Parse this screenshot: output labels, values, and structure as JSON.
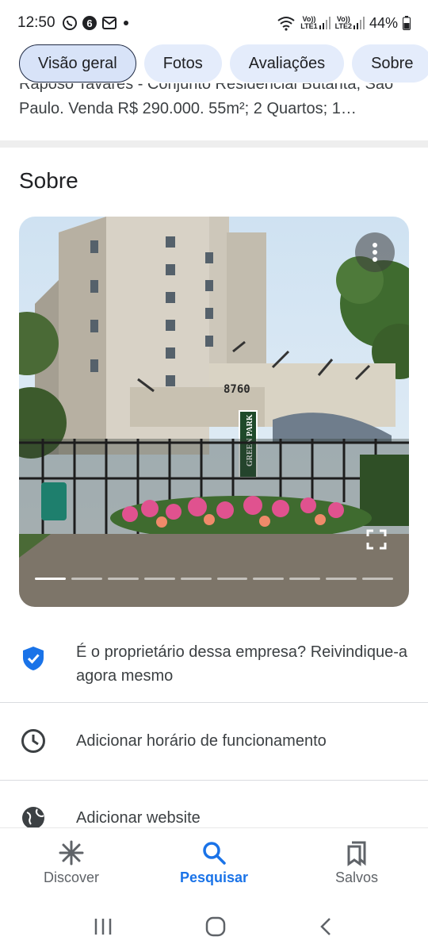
{
  "status_bar": {
    "time": "12:50",
    "battery": "44%",
    "sim1": "LTE1",
    "sim2": "LTE2",
    "volte": "Vo))"
  },
  "tabs": [
    {
      "label": "Visão geral",
      "active": true
    },
    {
      "label": "Fotos",
      "active": false
    },
    {
      "label": "Avaliações",
      "active": false
    },
    {
      "label": "Sobre",
      "active": false
    }
  ],
  "description": {
    "line1": "Raposo Tavares - Conjunto Residencial Butantã, São",
    "line2": "Paulo. Venda R$ 290.000. 55m²; 2 Quartos; 1…"
  },
  "about": {
    "title": "Sobre",
    "photo": {
      "building_number": "8760",
      "sign_text": "GREEN PARK",
      "slide_count": 10,
      "active_slide": 1
    }
  },
  "info_rows": [
    {
      "icon": "verified-shield-icon",
      "text": "É o proprietário dessa empresa? Reivindique-a agora mesmo"
    },
    {
      "icon": "clock-icon",
      "text": "Adicionar horário de funcionamento"
    },
    {
      "icon": "globe-icon",
      "text": "Adicionar website"
    }
  ],
  "bottom_nav": [
    {
      "label": "Discover",
      "icon": "discover-asterisk-icon",
      "active": false
    },
    {
      "label": "Pesquisar",
      "icon": "search-icon",
      "active": true
    },
    {
      "label": "Salvos",
      "icon": "bookmarks-icon",
      "active": false
    }
  ],
  "colors": {
    "accent": "#1a73e8",
    "tab_bg": "#e4ecfb",
    "text_secondary": "#3c4043"
  }
}
